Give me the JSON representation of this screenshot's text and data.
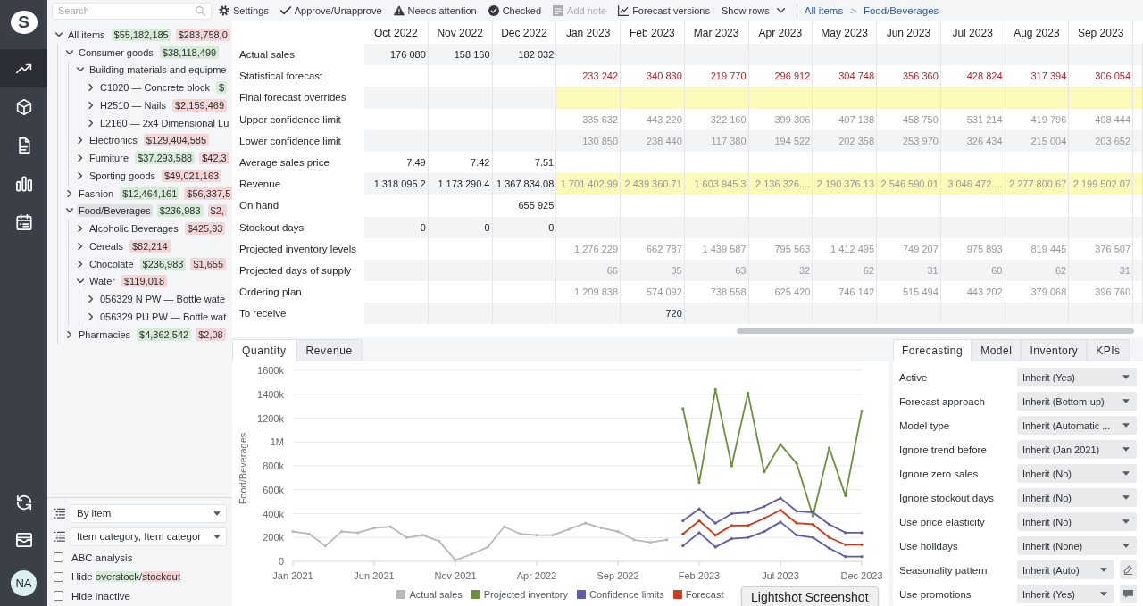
{
  "rail": {
    "logo": "S",
    "nav": [
      {
        "kind": "trend",
        "selected": true
      },
      {
        "kind": "cube",
        "selected": false
      },
      {
        "kind": "document",
        "selected": false
      },
      {
        "kind": "bars",
        "selected": false
      },
      {
        "kind": "calendar",
        "selected": false
      }
    ],
    "tools": [
      {
        "kind": "sync"
      },
      {
        "kind": "inbox"
      }
    ],
    "avatar": "NA"
  },
  "search": {
    "placeholder": "Search"
  },
  "toolbar": {
    "items": [
      {
        "kind": "settings",
        "label": "Settings",
        "disabled": false
      },
      {
        "kind": "approve",
        "label": "Approve/Unapprove",
        "disabled": false
      },
      {
        "kind": "attention",
        "label": "Needs attention",
        "disabled": false
      },
      {
        "kind": "checked",
        "label": "Checked",
        "disabled": false
      },
      {
        "kind": "note",
        "label": "Add note",
        "disabled": true
      },
      {
        "kind": "versions",
        "label": "Forecast versions",
        "disabled": false
      },
      {
        "kind": "menu",
        "label": "Show rows",
        "disabled": false
      }
    ],
    "breadcrumb": {
      "items": [
        "All items",
        "Food/Beverages"
      ],
      "separator": ">"
    }
  },
  "tree": [
    {
      "label": "All items",
      "expanded": true,
      "selected": false,
      "badges": [
        {
          "text": "$55,182,185",
          "kind": "overstock"
        },
        {
          "text": "$283,758,0",
          "kind": "stockout"
        }
      ],
      "children": [
        {
          "label": "Consumer goods",
          "expanded": true,
          "selected": false,
          "badges": [
            {
              "text": "$38,118,499",
              "kind": "overstock"
            }
          ],
          "children": [
            {
              "label": "Building materials and equipme",
              "expanded": true,
              "selected": false,
              "children": [
                {
                  "label": "C1020 — Concrete block",
                  "expanded": false,
                  "selected": false,
                  "badges": [
                    {
                      "text": "$",
                      "kind": "overstock"
                    }
                  ]
                },
                {
                  "label": "H2510 — Nails",
                  "expanded": false,
                  "selected": false,
                  "badges": [
                    {
                      "text": "$2,159,469",
                      "kind": "stockout"
                    }
                  ]
                },
                {
                  "label": "L2160 — 2x4 Dimensional Lu",
                  "expanded": false,
                  "selected": false
                }
              ]
            },
            {
              "label": "Electronics",
              "expanded": false,
              "selected": false,
              "badges": [
                {
                  "text": "$129,404,585",
                  "kind": "stockout"
                }
              ]
            },
            {
              "label": "Furniture",
              "expanded": false,
              "selected": false,
              "badges": [
                {
                  "text": "$37,293,588",
                  "kind": "overstock"
                },
                {
                  "text": "$42,3",
                  "kind": "stockout"
                }
              ]
            },
            {
              "label": "Sporting goods",
              "expanded": false,
              "selected": false,
              "badges": [
                {
                  "text": "$49,021,163",
                  "kind": "stockout"
                }
              ]
            }
          ]
        },
        {
          "label": "Fashion",
          "expanded": false,
          "selected": false,
          "badges": [
            {
              "text": "$12,464,161",
              "kind": "overstock"
            },
            {
              "text": "$56,337,5",
              "kind": "stockout"
            }
          ]
        },
        {
          "label": "Food/Beverages",
          "expanded": true,
          "selected": true,
          "badges": [
            {
              "text": "$236,983",
              "kind": "overstock"
            },
            {
              "text": "$2,",
              "kind": "stockout"
            }
          ],
          "children": [
            {
              "label": "Alcoholic Beverages",
              "expanded": false,
              "selected": false,
              "badges": [
                {
                  "text": "$425,93",
                  "kind": "stockout"
                }
              ]
            },
            {
              "label": "Cereals",
              "expanded": false,
              "selected": false,
              "badges": [
                {
                  "text": "$82,214",
                  "kind": "stockout"
                }
              ]
            },
            {
              "label": "Chocolate",
              "expanded": false,
              "selected": false,
              "badges": [
                {
                  "text": "$236,983",
                  "kind": "overstock"
                },
                {
                  "text": "$1,655",
                  "kind": "stockout"
                }
              ]
            },
            {
              "label": "Water",
              "expanded": true,
              "selected": false,
              "badges": [
                {
                  "text": "$119,018",
                  "kind": "stockout"
                }
              ],
              "children": [
                {
                  "label": "056329 N PW — Bottle wate",
                  "expanded": false,
                  "selected": false
                },
                {
                  "label": "056329 PU PW — Bottle wat",
                  "expanded": false,
                  "selected": false
                }
              ]
            }
          ]
        },
        {
          "label": "Pharmacies",
          "expanded": false,
          "selected": false,
          "badges": [
            {
              "text": "$4,362,542",
              "kind": "overstock"
            },
            {
              "text": "$2,08",
              "kind": "stockout"
            }
          ]
        }
      ]
    }
  ],
  "grouping": {
    "selects": [
      {
        "value": "By item"
      },
      {
        "value": "Item category, Item categor"
      }
    ],
    "options": [
      {
        "parts": [
          {
            "text": "ABC analysis"
          }
        ],
        "checked": false
      },
      {
        "parts": [
          {
            "text": "Hide "
          },
          {
            "text": "overstock",
            "kind": "overstock"
          },
          {
            "text": "/"
          },
          {
            "text": "stockout",
            "kind": "stockout"
          }
        ],
        "checked": false
      },
      {
        "parts": [
          {
            "text": "Hide inactive"
          }
        ],
        "checked": false
      }
    ]
  },
  "table": {
    "columns": [
      {
        "label": "Oct 2022",
        "forecast": false
      },
      {
        "label": "Nov 2022",
        "forecast": false
      },
      {
        "label": "Dec 2022",
        "forecast": false
      },
      {
        "label": "Jan 2023",
        "forecast": true
      },
      {
        "label": "Feb 2023",
        "forecast": true
      },
      {
        "label": "Mar 2023",
        "forecast": true
      },
      {
        "label": "Apr 2023",
        "forecast": true
      },
      {
        "label": "May 2023",
        "forecast": true
      },
      {
        "label": "Jun 2023",
        "forecast": true
      },
      {
        "label": "Jul 2023",
        "forecast": true
      },
      {
        "label": "Aug 2023",
        "forecast": true
      },
      {
        "label": "Sep 2023",
        "forecast": true
      }
    ],
    "rows": [
      {
        "label": "Actual sales",
        "kind": "actual",
        "values": {
          "Oct 2022": "176 080",
          "Nov 2022": "158 160",
          "Dec 2022": "182 032"
        }
      },
      {
        "label": "Statistical forecast",
        "kind": "forecast",
        "values": {
          "Jan 2023": "233 242",
          "Feb 2023": "340 830",
          "Mar 2023": "219 770",
          "Apr 2023": "296 912",
          "May 2023": "304 748",
          "Jun 2023": "356 360",
          "Jul 2023": "428 824",
          "Aug 2023": "317 394",
          "Sep 2023": "306 054"
        }
      },
      {
        "label": "Final forecast overrides",
        "kind": "editable"
      },
      {
        "label": "Upper confidence limit",
        "kind": "projected",
        "values": {
          "Jan 2023": "335 632",
          "Feb 2023": "443 220",
          "Mar 2023": "322 160",
          "Apr 2023": "399 306",
          "May 2023": "407 138",
          "Jun 2023": "458 750",
          "Jul 2023": "531 214",
          "Aug 2023": "419 796",
          "Sep 2023": "408 444"
        }
      },
      {
        "label": "Lower confidence limit",
        "kind": "projected",
        "values": {
          "Jan 2023": "130 850",
          "Feb 2023": "238 440",
          "Mar 2023": "117 380",
          "Apr 2023": "194 522",
          "May 2023": "202 358",
          "Jun 2023": "253 970",
          "Jul 2023": "326 434",
          "Aug 2023": "215 004",
          "Sep 2023": "203 652"
        }
      },
      {
        "label": "Average sales price",
        "kind": "actual",
        "values": {
          "Oct 2022": "7.49",
          "Nov 2022": "7.42",
          "Dec 2022": "7.51"
        }
      },
      {
        "label": "Revenue",
        "kind": "editable",
        "values": {
          "Oct 2022": "1 318 095.2",
          "Nov 2022": "1 173 290.4",
          "Dec 2022": "1 367 834.08",
          "Jan 2023": "1 701 402.99",
          "Feb 2023": "2 439 360.71",
          "Mar 2023": "1 603 945.3",
          "Apr 2023": "2 136 326....",
          "May 2023": "2 190 376.13",
          "Jun 2023": "2 546 590.01",
          "Jul 2023": "3 046 472....",
          "Aug 2023": "2 277 800.67",
          "Sep 2023": "2 199 502.07"
        }
      },
      {
        "label": "On hand",
        "kind": "actual",
        "values": {
          "Dec 2022": "655 925"
        }
      },
      {
        "label": "Stockout days",
        "kind": "actual",
        "values": {
          "Oct 2022": "0",
          "Nov 2022": "0",
          "Dec 2022": "0"
        }
      },
      {
        "label": "Projected inventory levels",
        "kind": "projected",
        "values": {
          "Jan 2023": "1 276 229",
          "Feb 2023": "662 787",
          "Mar 2023": "1 439 587",
          "Apr 2023": "795 563",
          "May 2023": "1 412 495",
          "Jun 2023": "749 207",
          "Jul 2023": "975 893",
          "Aug 2023": "819 445",
          "Sep 2023": "376 507"
        }
      },
      {
        "label": "Projected days of supply",
        "kind": "projected",
        "values": {
          "Jan 2023": "66",
          "Feb 2023": "35",
          "Mar 2023": "63",
          "Apr 2023": "32",
          "May 2023": "62",
          "Jun 2023": "31",
          "Jul 2023": "60",
          "Aug 2023": "62",
          "Sep 2023": "31"
        }
      },
      {
        "label": "Ordering plan",
        "kind": "projected",
        "values": {
          "Jan 2023": "1 209 838",
          "Feb 2023": "574 092",
          "Mar 2023": "738 558",
          "Apr 2023": "625 420",
          "May 2023": "746 142",
          "Jun 2023": "515 494",
          "Jul 2023": "443 202",
          "Aug 2023": "379 068",
          "Sep 2023": "396 760"
        }
      },
      {
        "label": "To receive",
        "kind": "actual",
        "values": {
          "Feb 2023": "720"
        }
      }
    ]
  },
  "chart_panel": {
    "tabs": [
      {
        "label": "Quantity",
        "selected": true
      },
      {
        "label": "Revenue",
        "selected": false
      }
    ],
    "chart_data": {
      "type": "line",
      "ylabel": "Food/Beverages",
      "grid": true,
      "legend": "bottom",
      "categories": [
        "Jan 2021",
        null,
        null,
        null,
        null,
        "Jun 2021",
        null,
        null,
        null,
        null,
        "Nov 2021",
        null,
        null,
        null,
        null,
        "Apr 2022",
        null,
        null,
        null,
        null,
        "Sep 2022",
        null,
        null,
        null,
        null,
        "Feb 2023",
        null,
        null,
        null,
        null,
        "Jul 2023",
        null,
        null,
        null,
        null,
        "Dec 2023"
      ],
      "ylim": [
        0,
        1600000
      ],
      "yticks": [
        {
          "value": 0,
          "label": "0"
        },
        {
          "value": 200000,
          "label": "200k"
        },
        {
          "value": 400000,
          "label": "400k"
        },
        {
          "value": 600000,
          "label": "600k"
        },
        {
          "value": 800000,
          "label": "800k"
        },
        {
          "value": 1000000,
          "label": "1M"
        },
        {
          "value": 1200000,
          "label": "1200k"
        },
        {
          "value": 1400000,
          "label": "1400k"
        },
        {
          "value": 1600000,
          "label": "1600k"
        }
      ],
      "series": [
        {
          "name": "Actual sales",
          "color": "#b8b8b8",
          "values": [
            250000,
            230000,
            130000,
            250000,
            240000,
            280000,
            290000,
            200000,
            220000,
            170000,
            10000,
            60000,
            120000,
            290000,
            230000,
            220000,
            220000,
            270000,
            320000,
            280000,
            250000,
            180000,
            160000,
            180000,
            null,
            null,
            null,
            null,
            null,
            null,
            null,
            null,
            null,
            null,
            null,
            null
          ]
        },
        {
          "name": "Projected inventory",
          "color": "#6b8f3e",
          "values": [
            null,
            null,
            null,
            null,
            null,
            null,
            null,
            null,
            null,
            null,
            null,
            null,
            null,
            null,
            null,
            null,
            null,
            null,
            null,
            null,
            null,
            null,
            null,
            null,
            1280000,
            660000,
            1440000,
            800000,
            1410000,
            750000,
            980000,
            820000,
            380000,
            950000,
            550000,
            1260000
          ]
        },
        {
          "name": "Confidence limits",
          "color": "#5c5ca8",
          "values": [
            null,
            null,
            null,
            null,
            null,
            null,
            null,
            null,
            null,
            null,
            null,
            null,
            null,
            null,
            null,
            null,
            null,
            null,
            null,
            null,
            null,
            null,
            null,
            null,
            340000,
            440000,
            320000,
            400000,
            410000,
            460000,
            530000,
            420000,
            410000,
            310000,
            240000,
            240000
          ]
        },
        {
          "color": "#5c5ca8",
          "values": [
            null,
            null,
            null,
            null,
            null,
            null,
            null,
            null,
            null,
            null,
            null,
            null,
            null,
            null,
            null,
            null,
            null,
            null,
            null,
            null,
            null,
            null,
            null,
            null,
            130000,
            240000,
            120000,
            190000,
            200000,
            250000,
            330000,
            220000,
            200000,
            110000,
            40000,
            40000
          ]
        },
        {
          "name": "Forecast",
          "color": "#cc3b1d",
          "values": [
            null,
            null,
            null,
            null,
            null,
            null,
            null,
            null,
            null,
            null,
            null,
            null,
            null,
            null,
            null,
            null,
            null,
            null,
            null,
            null,
            null,
            null,
            null,
            null,
            230000,
            340000,
            220000,
            300000,
            300000,
            360000,
            430000,
            320000,
            310000,
            200000,
            140000,
            140000
          ]
        }
      ]
    }
  },
  "settings_panel": {
    "tabs": [
      {
        "label": "Forecasting",
        "selected": true
      },
      {
        "label": "Model",
        "selected": false
      },
      {
        "label": "Inventory",
        "selected": false
      },
      {
        "label": "KPIs",
        "selected": false
      }
    ],
    "fields": [
      {
        "label": "Active",
        "value": "Inherit (Yes)",
        "kind": "dropdown"
      },
      {
        "label": "Forecast approach",
        "value": "Inherit (Bottom-up)",
        "kind": "dropdown"
      },
      {
        "label": "Model type",
        "value": "Inherit (Automatic ...",
        "kind": "dropdown"
      },
      {
        "label": "Ignore trend before",
        "value": "Inherit (Jan 2021)",
        "kind": "dropdown"
      },
      {
        "label": "Ignore zero sales",
        "value": "Inherit (No)",
        "kind": "dropdown"
      },
      {
        "label": "Ignore stockout days",
        "value": "Inherit (No)",
        "kind": "dropdown"
      },
      {
        "label": "Use price elasticity",
        "value": "Inherit (No)",
        "kind": "dropdown"
      },
      {
        "label": "Use holidays",
        "value": "Inherit (None)",
        "kind": "dropdown"
      },
      {
        "label": "Seasonality pattern",
        "value": "Inherit (Auto)",
        "kind": "editable"
      },
      {
        "label": "Use promotions",
        "value": "Inherit (Yes)",
        "kind": "commentable"
      }
    ]
  },
  "tooltip": {
    "text": "Lightshot Screenshot"
  }
}
